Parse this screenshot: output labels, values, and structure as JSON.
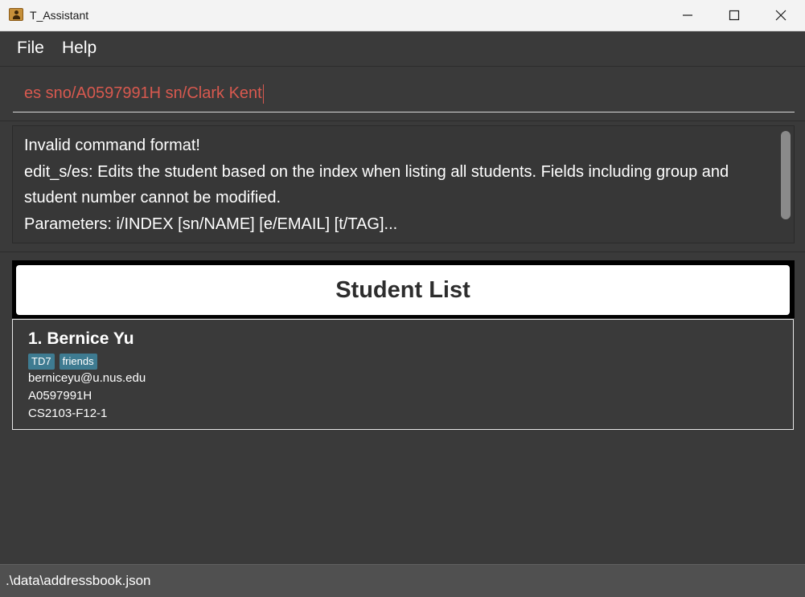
{
  "window": {
    "title": "T_Assistant"
  },
  "menu": {
    "items": [
      "File",
      "Help"
    ]
  },
  "command": {
    "value": "es sno/A0597991H sn/Clark Kent",
    "text_color": "#d8594f"
  },
  "result": {
    "lines": [
      "Invalid command format!",
      "edit_s/es: Edits the student based on the index when listing all students. Fields including group and",
      "student number cannot be modified.",
      "Parameters: i/INDEX [sn/NAME] [e/EMAIL] [t/TAG]..."
    ]
  },
  "list": {
    "header": "Student List",
    "students": [
      {
        "name": "1. Bernice Yu",
        "tags": [
          "TD7",
          "friends"
        ],
        "email": "berniceyu@u.nus.edu",
        "student_number": "A0597991H",
        "group": "CS2103-F12-1"
      }
    ]
  },
  "status": {
    "path": ".\\data\\addressbook.json"
  },
  "colors": {
    "background": "#3a3a3a",
    "tag": "#3e7b91",
    "statusbar": "#505050"
  },
  "icons": [
    "app-icon",
    "minimize-icon",
    "maximize-icon",
    "close-icon"
  ]
}
